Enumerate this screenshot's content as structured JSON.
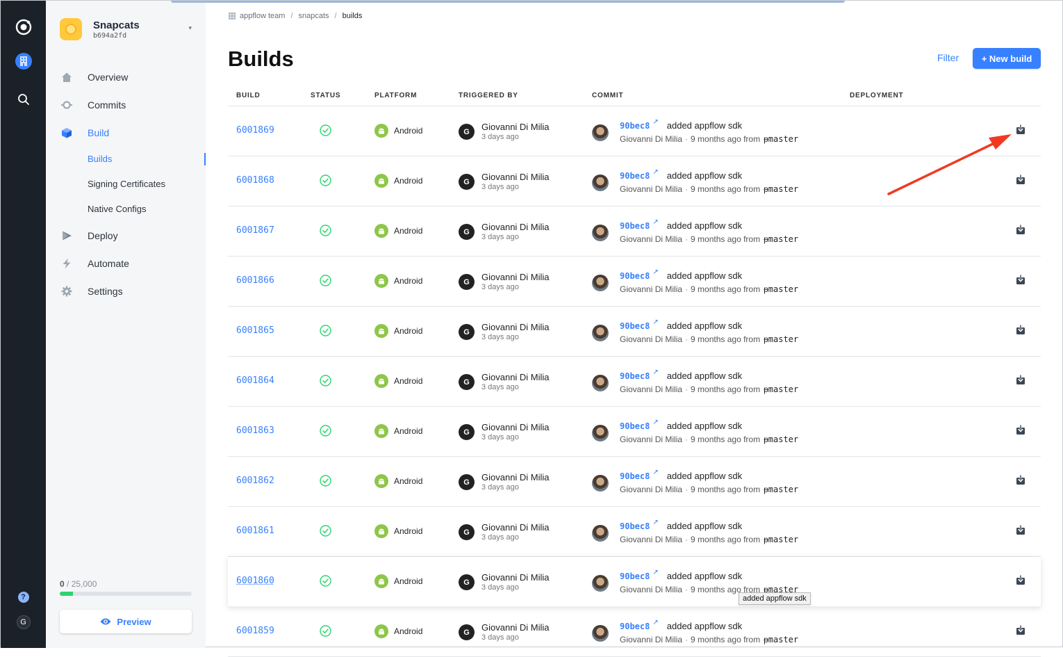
{
  "rail": {
    "icons": [
      "ionic-logo-icon",
      "org-building-icon",
      "search-icon",
      "help-icon",
      "user-avatar"
    ],
    "avatar_letter": "G",
    "help_label": "?"
  },
  "app": {
    "name": "Snapcats",
    "id": "b694a2fd",
    "accent": "#ffc83d"
  },
  "nav": {
    "items": [
      {
        "label": "Overview",
        "icon": "home-icon"
      },
      {
        "label": "Commits",
        "icon": "commit-icon"
      },
      {
        "label": "Build",
        "icon": "cube-icon"
      },
      {
        "label": "Deploy",
        "icon": "play-icon"
      },
      {
        "label": "Automate",
        "icon": "bolt-icon"
      },
      {
        "label": "Settings",
        "icon": "gear-icon"
      }
    ],
    "build_sub": [
      "Builds",
      "Signing Certificates",
      "Native Configs"
    ]
  },
  "usage": {
    "used": "0",
    "total": "/ 25,000",
    "fraction": 0.1
  },
  "preview": {
    "label": "Preview"
  },
  "breadcrumb": [
    "appflow team",
    "snapcats",
    "builds"
  ],
  "page": {
    "title": "Builds",
    "filter_label": "Filter",
    "new_build_label": "+ New build"
  },
  "table": {
    "headers": [
      "BUILD",
      "STATUS",
      "PLATFORM",
      "TRIGGERED BY",
      "COMMIT",
      "DEPLOYMENT"
    ],
    "rows": [
      {
        "id": "6001869",
        "status": "success",
        "platform": "Android",
        "user_initial": "G",
        "user": "Giovanni Di Milia",
        "ago": "3 days ago",
        "sha": "90bec8",
        "message": "added appflow sdk",
        "author": "Giovanni Di Milia",
        "when": "9 months ago from",
        "branch": "master"
      },
      {
        "id": "6001868",
        "status": "success",
        "platform": "Android",
        "user_initial": "G",
        "user": "Giovanni Di Milia",
        "ago": "3 days ago",
        "sha": "90bec8",
        "message": "added appflow sdk",
        "author": "Giovanni Di Milia",
        "when": "9 months ago from",
        "branch": "master"
      },
      {
        "id": "6001867",
        "status": "success",
        "platform": "Android",
        "user_initial": "G",
        "user": "Giovanni Di Milia",
        "ago": "3 days ago",
        "sha": "90bec8",
        "message": "added appflow sdk",
        "author": "Giovanni Di Milia",
        "when": "9 months ago from",
        "branch": "master"
      },
      {
        "id": "6001866",
        "status": "success",
        "platform": "Android",
        "user_initial": "G",
        "user": "Giovanni Di Milia",
        "ago": "3 days ago",
        "sha": "90bec8",
        "message": "added appflow sdk",
        "author": "Giovanni Di Milia",
        "when": "9 months ago from",
        "branch": "master"
      },
      {
        "id": "6001865",
        "status": "success",
        "platform": "Android",
        "user_initial": "G",
        "user": "Giovanni Di Milia",
        "ago": "3 days ago",
        "sha": "90bec8",
        "message": "added appflow sdk",
        "author": "Giovanni Di Milia",
        "when": "9 months ago from",
        "branch": "master"
      },
      {
        "id": "6001864",
        "status": "success",
        "platform": "Android",
        "user_initial": "G",
        "user": "Giovanni Di Milia",
        "ago": "3 days ago",
        "sha": "90bec8",
        "message": "added appflow sdk",
        "author": "Giovanni Di Milia",
        "when": "9 months ago from",
        "branch": "master"
      },
      {
        "id": "6001863",
        "status": "success",
        "platform": "Android",
        "user_initial": "G",
        "user": "Giovanni Di Milia",
        "ago": "3 days ago",
        "sha": "90bec8",
        "message": "added appflow sdk",
        "author": "Giovanni Di Milia",
        "when": "9 months ago from",
        "branch": "master"
      },
      {
        "id": "6001862",
        "status": "success",
        "platform": "Android",
        "user_initial": "G",
        "user": "Giovanni Di Milia",
        "ago": "3 days ago",
        "sha": "90bec8",
        "message": "added appflow sdk",
        "author": "Giovanni Di Milia",
        "when": "9 months ago from",
        "branch": "master"
      },
      {
        "id": "6001861",
        "status": "success",
        "platform": "Android",
        "user_initial": "G",
        "user": "Giovanni Di Milia",
        "ago": "3 days ago",
        "sha": "90bec8",
        "message": "added appflow sdk",
        "author": "Giovanni Di Milia",
        "when": "9 months ago from",
        "branch": "master"
      },
      {
        "id": "6001860",
        "status": "success",
        "platform": "Android",
        "user_initial": "G",
        "user": "Giovanni Di Milia",
        "ago": "3 days ago",
        "sha": "90bec8",
        "message": "added appflow sdk",
        "author": "Giovanni Di Milia",
        "when": "9 months ago from",
        "branch": "master",
        "hovered": true
      },
      {
        "id": "6001859",
        "status": "success",
        "platform": "Android",
        "user_initial": "G",
        "user": "Giovanni Di Milia",
        "ago": "3 days ago",
        "sha": "90bec8",
        "message": "added appflow sdk",
        "author": "Giovanni Di Milia",
        "when": "9 months ago from",
        "branch": "master"
      }
    ]
  },
  "tooltip": {
    "text": "added appflow sdk"
  },
  "colors": {
    "accent": "#3780ff",
    "success": "#2dd36f",
    "android": "#8ec64a",
    "annotation_arrow": "#f03a22"
  }
}
